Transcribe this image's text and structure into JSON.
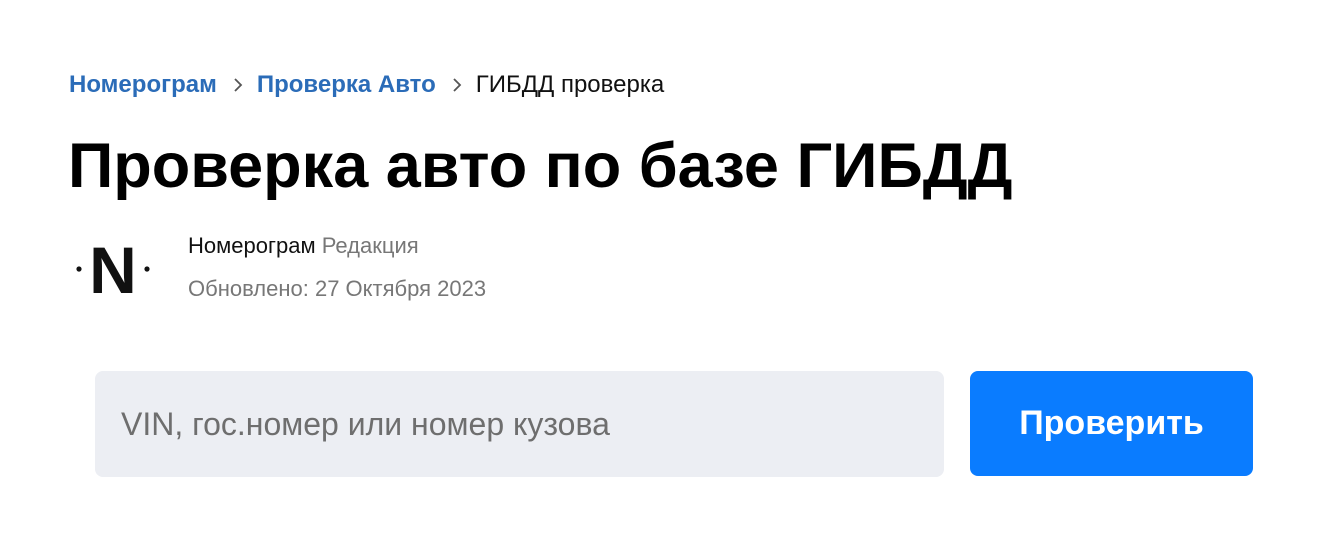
{
  "breadcrumb": {
    "items": [
      {
        "label": "Номерограм",
        "link": true
      },
      {
        "label": "Проверка Авто",
        "link": true
      },
      {
        "label": "ГИБДД проверка",
        "link": false
      }
    ],
    "separator_icon": "chevron-right-icon",
    "link_color": "#2b6cb8"
  },
  "page": {
    "title": "Проверка авто по базе ГИБДД"
  },
  "author": {
    "logo_letter": "N",
    "name": "Номерограм",
    "role": "Редакция",
    "updated": "Обновлено: 27 Октября 2023"
  },
  "search": {
    "placeholder": "VIN, гос.номер или номер кузова",
    "value": "",
    "button_label": "Проверить",
    "button_color": "#0a7cff",
    "input_background": "#eceef3"
  }
}
